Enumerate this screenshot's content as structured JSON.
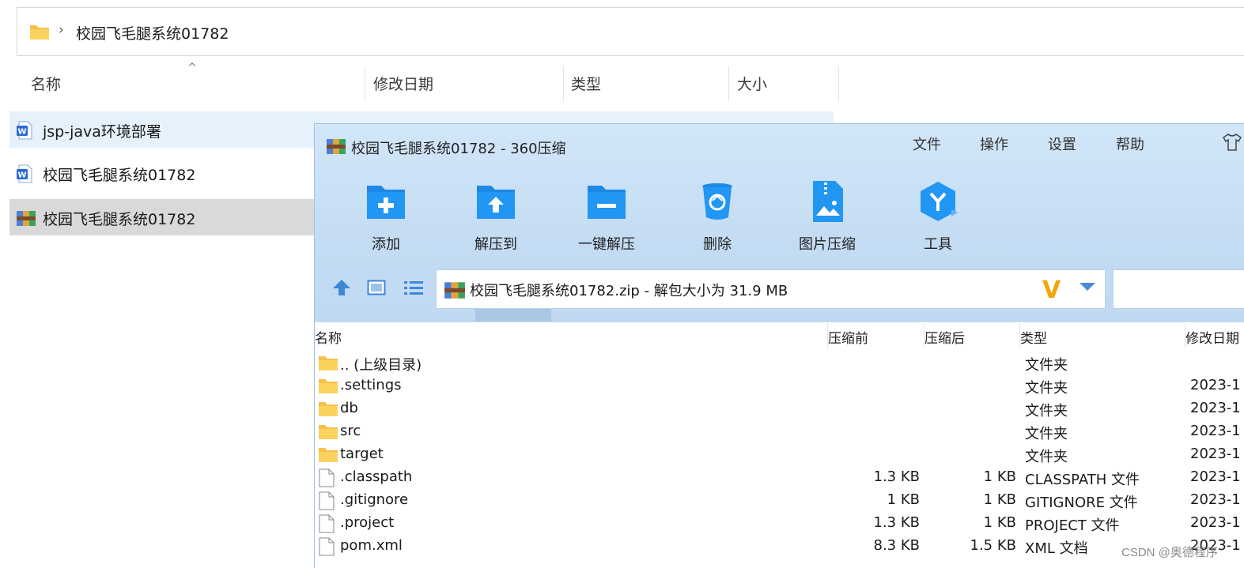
{
  "explorer": {
    "breadcrumb": "校园飞毛腿系统01782",
    "sort_caret": "^",
    "columns": {
      "name": "名称",
      "modified": "修改日期",
      "type": "类型",
      "size": "大小"
    },
    "files": [
      {
        "name": "jsp-java环境部署",
        "icon": "word-doc-icon",
        "state": "hover"
      },
      {
        "name": "校园飞毛腿系统01782",
        "icon": "word-doc-icon",
        "state": ""
      },
      {
        "name": "校园飞毛腿系统01782",
        "icon": "winrar-archive-icon",
        "state": "selected"
      }
    ]
  },
  "zip": {
    "title": "校园飞毛腿系统01782 - 360压缩",
    "menu": [
      "文件",
      "操作",
      "设置",
      "帮助"
    ],
    "toolbar": [
      {
        "label": "添加",
        "icon": "add-icon"
      },
      {
        "label": "解压到",
        "icon": "extract-to-icon"
      },
      {
        "label": "一键解压",
        "icon": "one-click-extract-icon"
      },
      {
        "label": "删除",
        "icon": "delete-icon"
      },
      {
        "label": "图片压缩",
        "icon": "image-compress-icon"
      },
      {
        "label": "工具",
        "icon": "tools-icon"
      }
    ],
    "path": "校园飞毛腿系统01782.zip - 解包大小为 31.9 MB",
    "columns": {
      "name": "名称",
      "before": "压缩前",
      "after": "压缩后",
      "type": "类型",
      "date": "修改日期"
    },
    "rows": [
      {
        "name": ".. (上级目录)",
        "kind": "folder",
        "before": "",
        "after": "",
        "type": "文件夹",
        "date": ""
      },
      {
        "name": ".settings",
        "kind": "folder",
        "before": "",
        "after": "",
        "type": "文件夹",
        "date": "2023-1"
      },
      {
        "name": "db",
        "kind": "folder",
        "before": "",
        "after": "",
        "type": "文件夹",
        "date": "2023-1"
      },
      {
        "name": "src",
        "kind": "folder",
        "before": "",
        "after": "",
        "type": "文件夹",
        "date": "2023-1"
      },
      {
        "name": "target",
        "kind": "folder",
        "before": "",
        "after": "",
        "type": "文件夹",
        "date": "2023-1"
      },
      {
        "name": ".classpath",
        "kind": "file",
        "before": "1.3 KB",
        "after": "1 KB",
        "type": "CLASSPATH 文件",
        "date": "2023-1"
      },
      {
        "name": ".gitignore",
        "kind": "file",
        "before": "1 KB",
        "after": "1 KB",
        "type": "GITIGNORE 文件",
        "date": "2023-1"
      },
      {
        "name": ".project",
        "kind": "file",
        "before": "1.3 KB",
        "after": "1 KB",
        "type": "PROJECT 文件",
        "date": "2023-1"
      },
      {
        "name": "pom.xml",
        "kind": "file",
        "before": "8.3 KB",
        "after": "1.5 KB",
        "type": "XML 文档",
        "date": "2023-1"
      }
    ]
  },
  "watermark": "CSDN @奥德程序"
}
